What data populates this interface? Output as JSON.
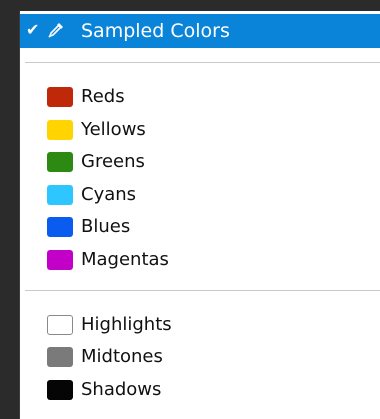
{
  "menu": {
    "selected": {
      "label": "Sampled Colors",
      "check_icon": "checkmark-icon",
      "tool_icon": "eyedropper-icon"
    },
    "color_items": [
      {
        "label": "Reds",
        "color": "#c0280a"
      },
      {
        "label": "Yellows",
        "color": "#ffd400"
      },
      {
        "label": "Greens",
        "color": "#2c8a12"
      },
      {
        "label": "Cyans",
        "color": "#2ec6ff"
      },
      {
        "label": "Blues",
        "color": "#0a5cf0"
      },
      {
        "label": "Magentas",
        "color": "#c200c8"
      }
    ],
    "tone_items": [
      {
        "label": "Highlights",
        "color": "#ffffff"
      },
      {
        "label": "Midtones",
        "color": "#7a7a7a"
      },
      {
        "label": "Shadows",
        "color": "#050505"
      }
    ],
    "selection_color": "#0a84d9"
  }
}
